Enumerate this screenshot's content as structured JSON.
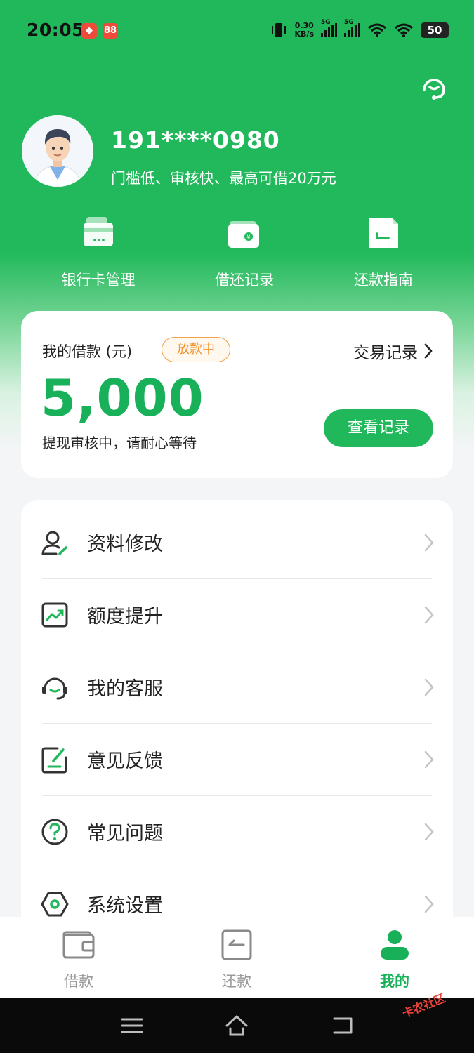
{
  "status_bar": {
    "time": "20:05",
    "net_speed_value": "0.30",
    "net_speed_unit": "KB/s",
    "sim1": "5G",
    "sim2": "5G",
    "battery": "50"
  },
  "profile": {
    "phone": "191****0980",
    "slogan": "门槛低、审核快、最高可借20万元"
  },
  "shortcuts": [
    {
      "label": "银行卡管理",
      "icon": "bank-card-icon"
    },
    {
      "label": "借还记录",
      "icon": "wallet-icon"
    },
    {
      "label": "还款指南",
      "icon": "guide-icon"
    }
  ],
  "loan_card": {
    "title": "我的借款 (元)",
    "badge": "放款中",
    "trade_link": "交易记录",
    "amount": "5,000",
    "note": "提现审核中，请耐心等待",
    "view_button": "查看记录"
  },
  "menu": [
    {
      "label": "资料修改",
      "icon": "user-edit-icon"
    },
    {
      "label": "额度提升",
      "icon": "trend-up-icon"
    },
    {
      "label": "我的客服",
      "icon": "headset-icon"
    },
    {
      "label": "意见反馈",
      "icon": "feedback-edit-icon"
    },
    {
      "label": "常见问题",
      "icon": "question-icon"
    },
    {
      "label": "系统设置",
      "icon": "settings-hex-icon"
    }
  ],
  "tabs": [
    {
      "label": "借款",
      "active": false
    },
    {
      "label": "还款",
      "active": false
    },
    {
      "label": "我的",
      "active": true
    }
  ],
  "watermark": "卡农社区",
  "colors": {
    "brand_green": "#20b85a",
    "amount_green": "#19b05a",
    "badge_orange": "#f08f2a"
  }
}
